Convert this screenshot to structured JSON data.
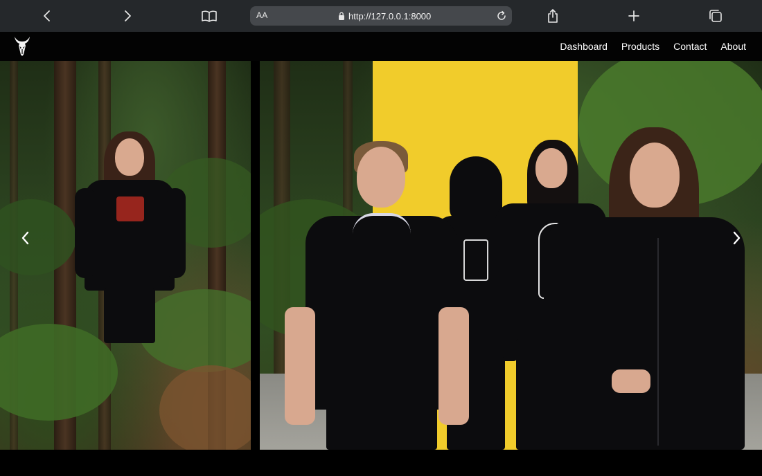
{
  "browser": {
    "address": {
      "text_size_label": "AA",
      "url": "http://127.0.0.1:8000"
    },
    "icons": {
      "back": "chevron-left-icon",
      "forward": "chevron-right-icon",
      "bookmarks": "book-icon",
      "secure": "lock-icon",
      "reload": "reload-icon",
      "share": "share-icon",
      "new_tab": "plus-icon",
      "tabs": "tabs-icon"
    }
  },
  "site": {
    "logo_icon": "horned-skull-logo",
    "nav": {
      "items": [
        {
          "label": "Dashboard"
        },
        {
          "label": "Products"
        },
        {
          "label": "Contact"
        },
        {
          "label": "About"
        }
      ]
    }
  },
  "carousel": {
    "prev_icon": "chevron-left-icon",
    "next_icon": "chevron-right-icon",
    "slides": [
      {
        "scene": "forest"
      },
      {
        "scene": "forest-yellow-backdrop"
      }
    ]
  },
  "colors": {
    "toolbar_bg": "#25282b",
    "address_bg": "#45484c",
    "nav_bg": "#030303",
    "accent_yellow": "#f1cc2b",
    "apparel_black": "#0c0c0e",
    "foliage_green": "#34502a"
  }
}
